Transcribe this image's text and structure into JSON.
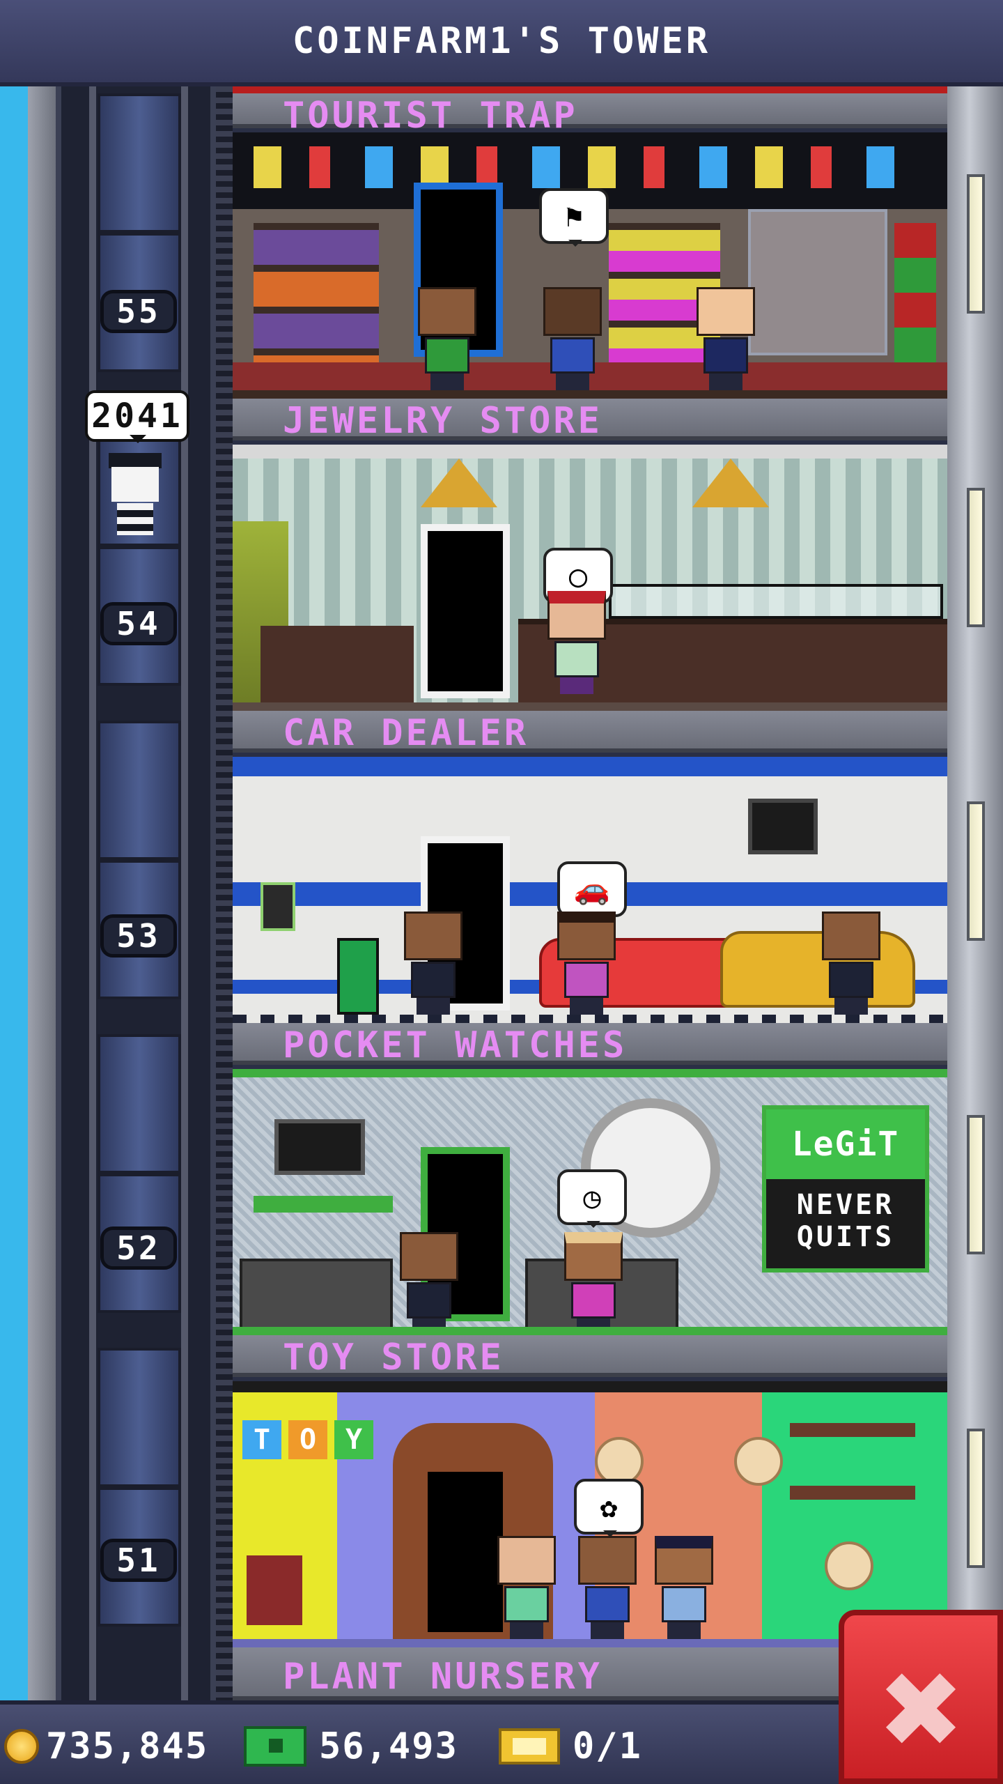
{
  "title": "COINFARM1'S TOWER",
  "elevator": {
    "floors": [
      "55",
      "54",
      "53",
      "52",
      "51"
    ],
    "passenger_bubble": "2041"
  },
  "floors": [
    {
      "name": "TOURIST TRAP",
      "color": "#e58cf2"
    },
    {
      "name": "JEWELRY STORE",
      "color": "#e58cf2"
    },
    {
      "name": "CAR DEALER",
      "color": "#e58cf2"
    },
    {
      "name": "POCKET WATCHES",
      "color": "#e58cf2"
    },
    {
      "name": "TOY STORE",
      "color": "#e58cf2"
    },
    {
      "name": "PLANT NURSERY",
      "color": "#e58cf2"
    }
  ],
  "signs": {
    "legit_top": "LeGiT",
    "legit_bottom_1": "NEVER",
    "legit_bottom_2": "QUITS",
    "toy_letters": [
      "T",
      "O",
      "Y"
    ]
  },
  "hud": {
    "coins": "735,845",
    "bux": "56,493",
    "tickets": "0/1"
  },
  "icons": {
    "coin": "coin-icon",
    "cash": "cash-icon",
    "ticket": "golden-ticket-icon",
    "close": "close-icon"
  }
}
